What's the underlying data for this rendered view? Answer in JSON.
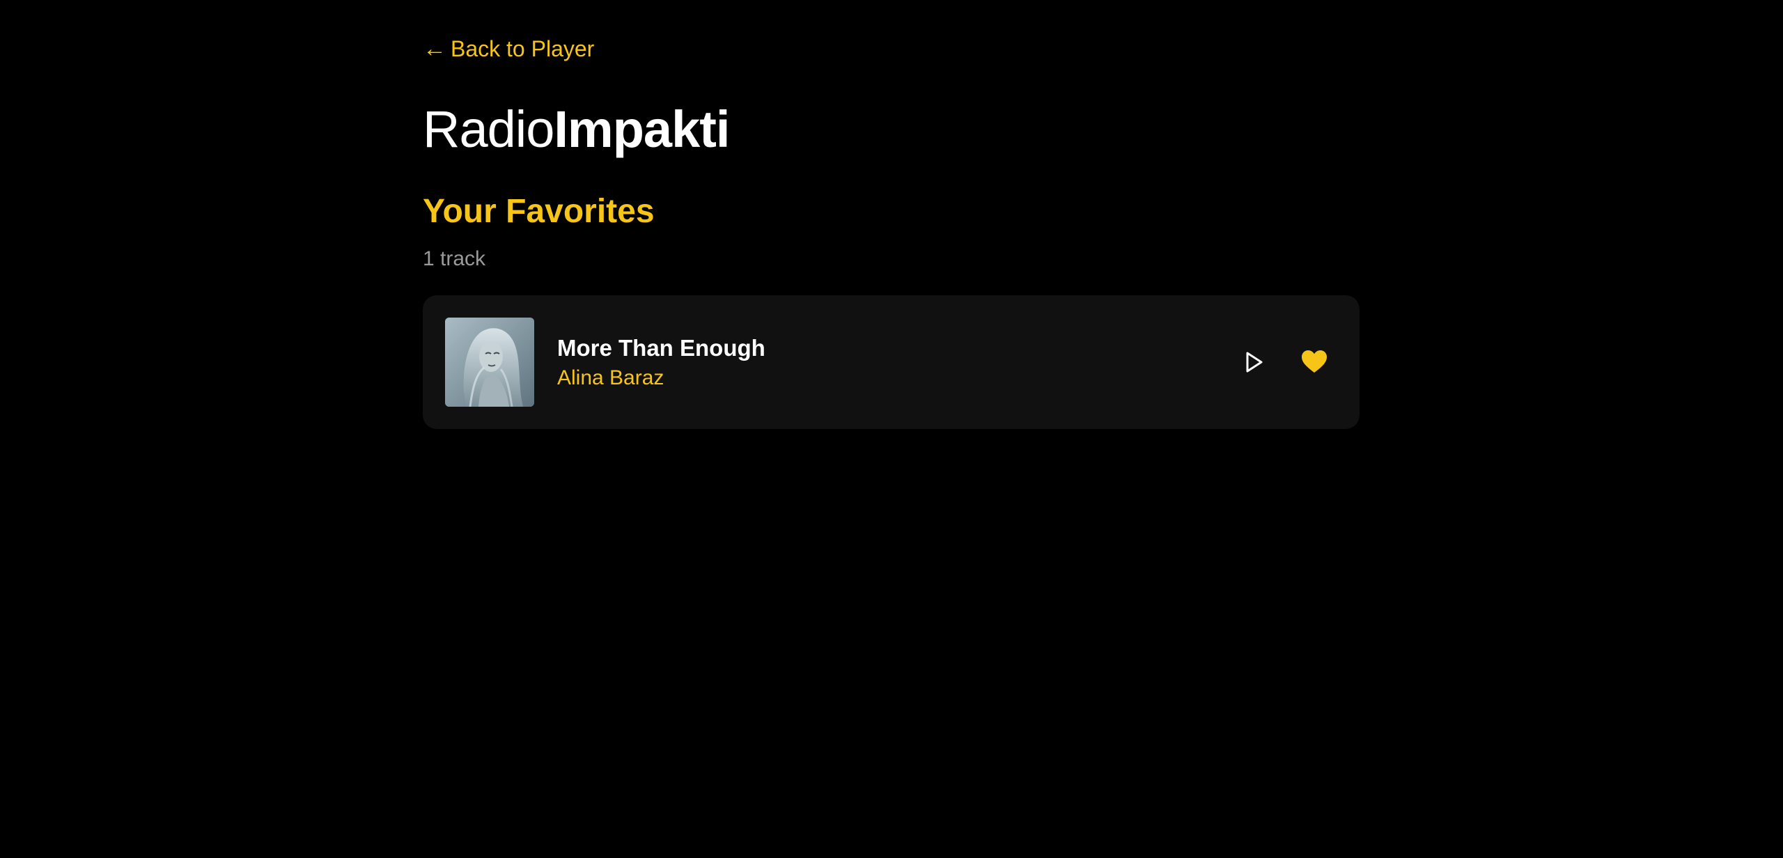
{
  "nav": {
    "back_label": "Back to Player",
    "back_icon": "arrow-left-icon"
  },
  "brand": {
    "light": "Radio",
    "bold": "Impakti"
  },
  "favorites": {
    "title": "Your Favorites",
    "count_label": "1 track",
    "tracks": [
      {
        "title": "More Than Enough",
        "artist": "Alina Baraz",
        "cover_icon": "album-cover-image",
        "actions": [
          {
            "icon": "play-icon"
          },
          {
            "icon": "heart-filled-icon"
          }
        ]
      }
    ]
  },
  "colors": {
    "background": "#000000",
    "accent": "#f7c418",
    "card": "#111111",
    "muted_text": "#9a9a9a",
    "text": "#ffffff"
  }
}
